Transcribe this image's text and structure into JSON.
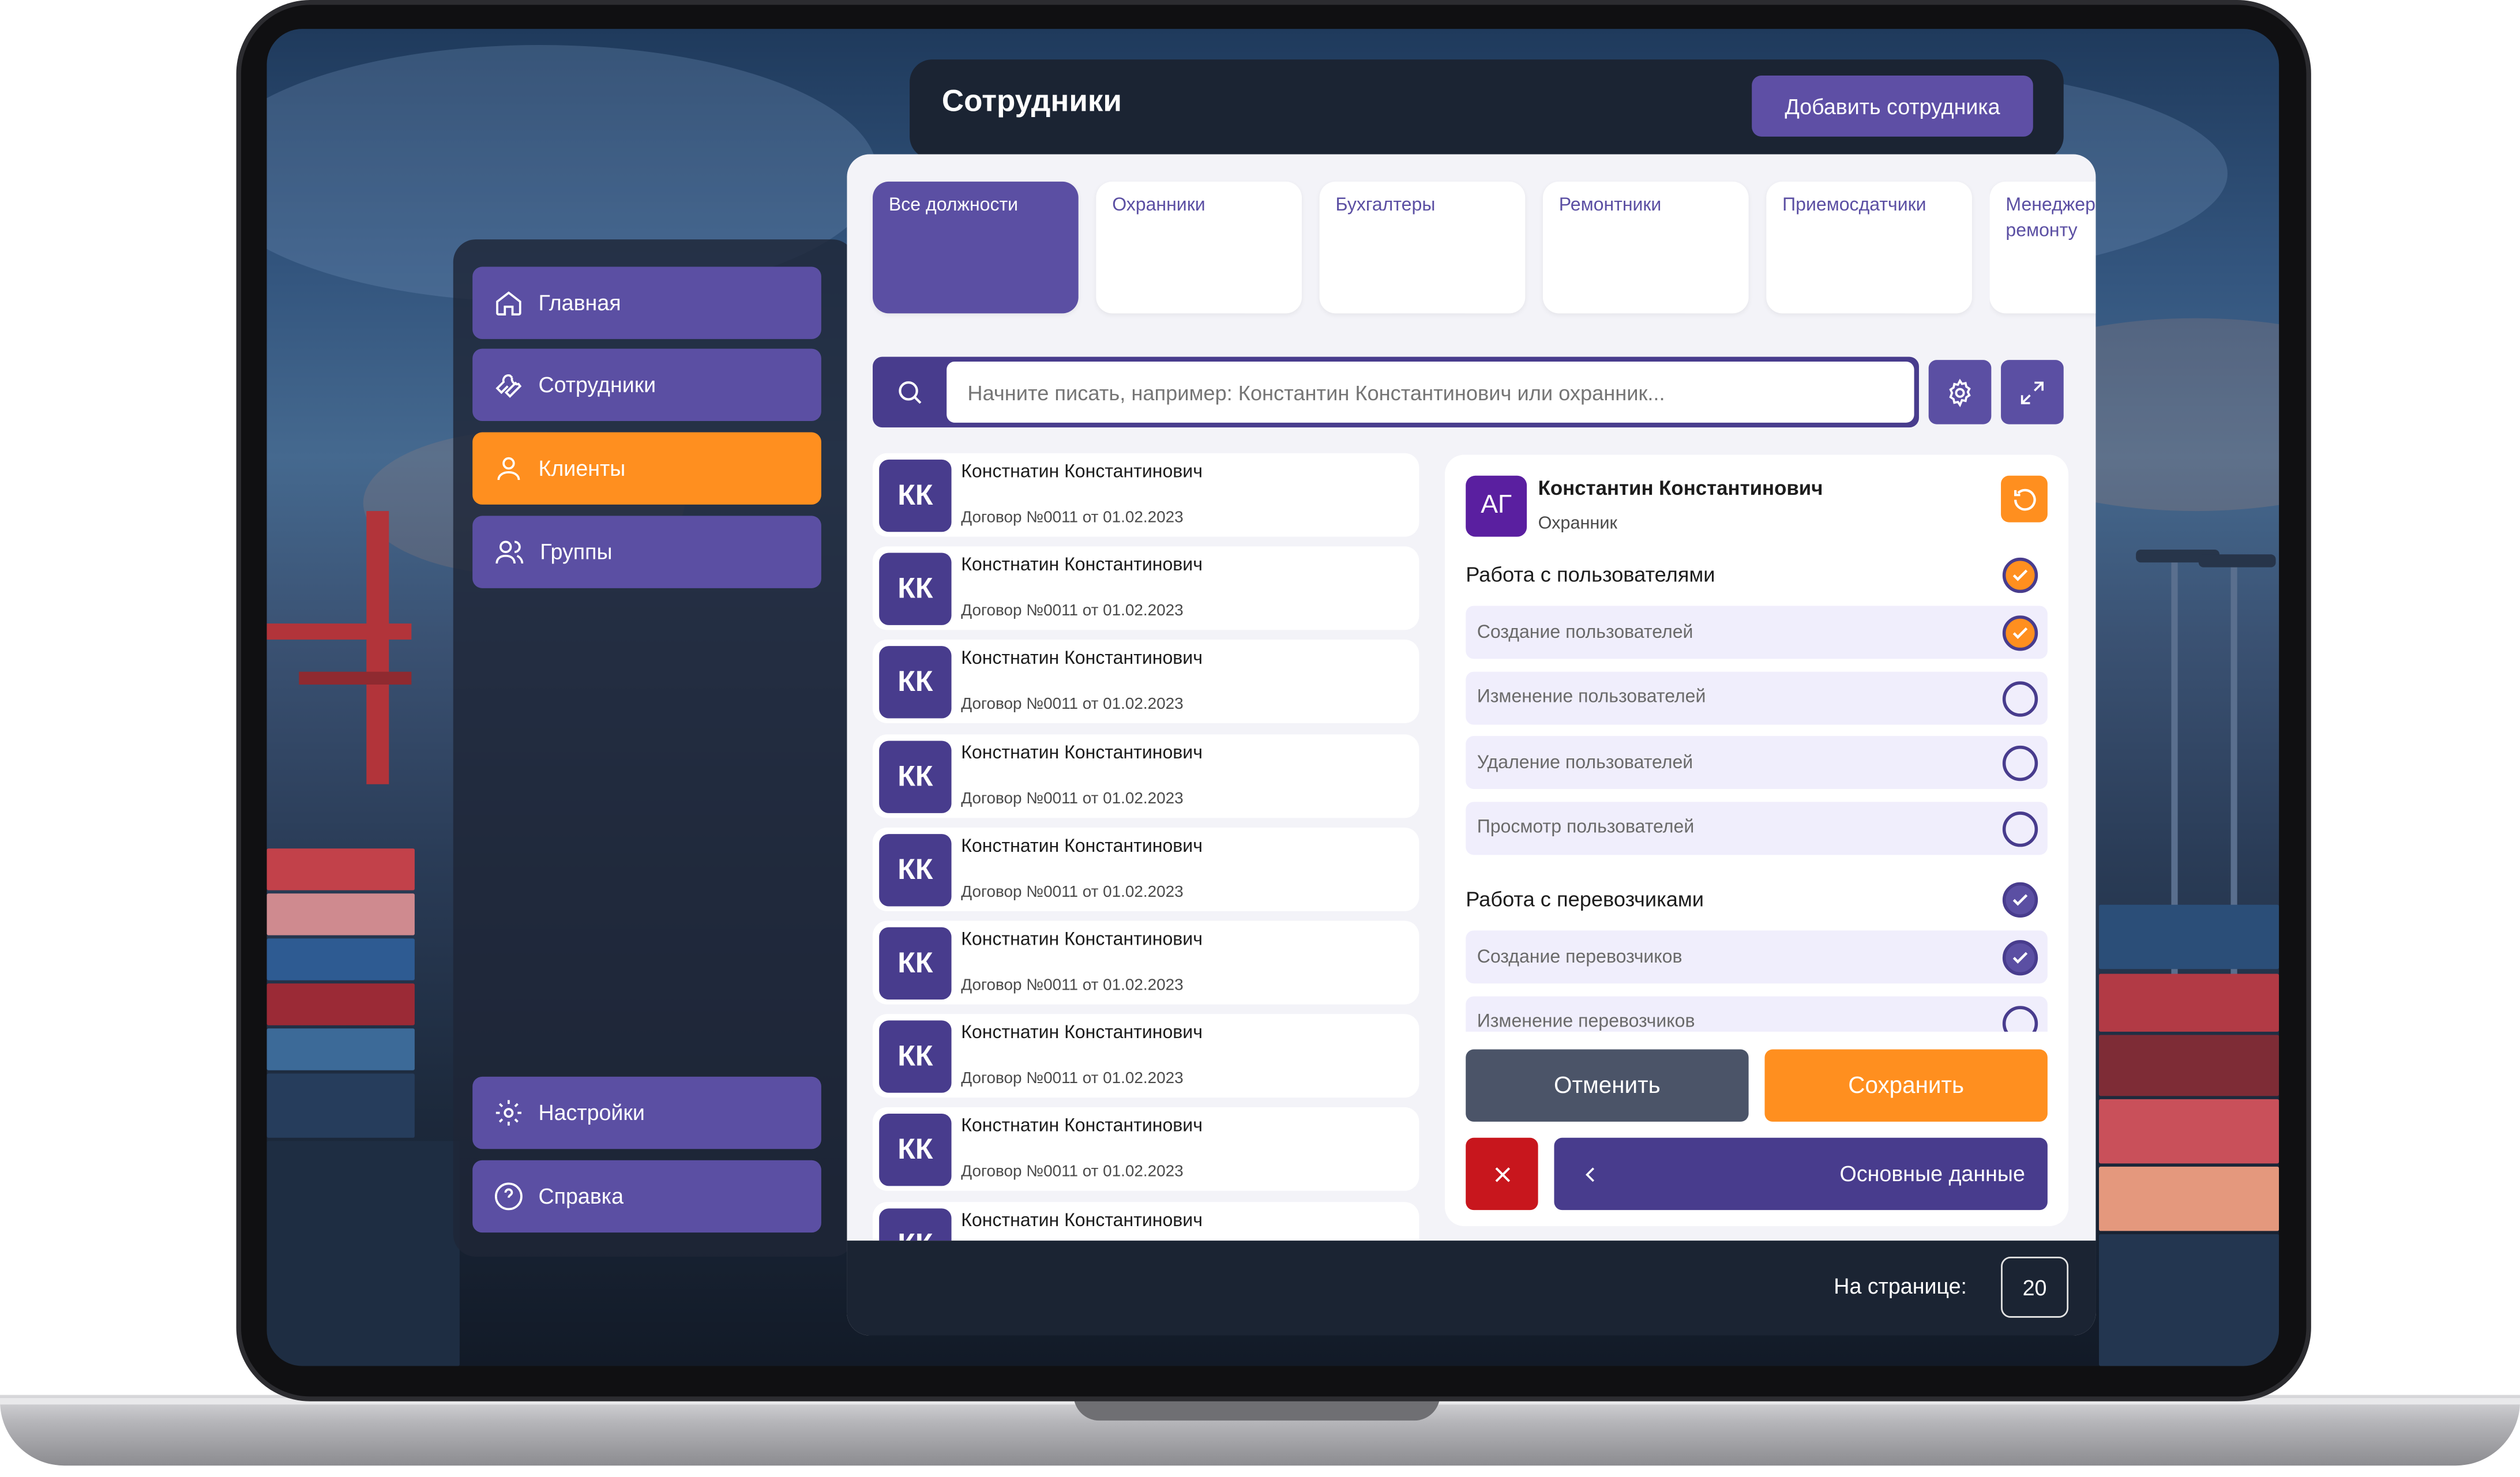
{
  "header": {
    "title": "Сотрудники",
    "add_button": "Добавить сотрудника"
  },
  "sidebar": {
    "items": [
      {
        "label": "Главная",
        "icon": "home-icon"
      },
      {
        "label": "Сотрудники",
        "icon": "wrench-icon"
      },
      {
        "label": "Клиенты",
        "icon": "user-icon",
        "active": true
      },
      {
        "label": "Группы",
        "icon": "users-icon"
      }
    ],
    "bottom": [
      {
        "label": "Настройки",
        "icon": "gear-icon"
      },
      {
        "label": "Справка",
        "icon": "help-icon"
      }
    ]
  },
  "tabs": [
    {
      "label": "Все должности",
      "active": true
    },
    {
      "label": "Охранники"
    },
    {
      "label": "Бухгалтеры"
    },
    {
      "label": "Ремонтники"
    },
    {
      "label": "Приемосдатчики"
    },
    {
      "label": "Менеджер по ремонту"
    }
  ],
  "search": {
    "placeholder": "Начните писать, например: Константин Константинович или охранник..."
  },
  "list": {
    "rows": [
      {
        "initials": "КК",
        "name": "Констнатин Константинович",
        "contract": "Договор №0011 от 01.02.2023"
      },
      {
        "initials": "КК",
        "name": "Констнатин Константинович",
        "contract": "Договор №0011 от 01.02.2023"
      },
      {
        "initials": "КК",
        "name": "Констнатин Константинович",
        "contract": "Договор №0011 от 01.02.2023"
      },
      {
        "initials": "КК",
        "name": "Констнатин Константинович",
        "contract": "Договор №0011 от 01.02.2023"
      },
      {
        "initials": "КК",
        "name": "Констнатин Константинович",
        "contract": "Договор №0011 от 01.02.2023"
      },
      {
        "initials": "КК",
        "name": "Констнатин Константинович",
        "contract": "Договор №0011 от 01.02.2023"
      },
      {
        "initials": "КК",
        "name": "Констнатин Константинович",
        "contract": "Договор №0011 от 01.02.2023"
      },
      {
        "initials": "КК",
        "name": "Констнатин Константинович",
        "contract": "Договор №0011 от 01.02.2023"
      },
      {
        "initials": "КК",
        "name": "Констнатин Константинович",
        "contract": ""
      }
    ]
  },
  "detail": {
    "initials": "АГ",
    "name": "Константин Константинович",
    "role": "Охранник",
    "sections": [
      {
        "title": "Работа с пользователями",
        "checked": true,
        "checked_color": "#ff8f1f",
        "items": [
          {
            "label": "Создание пользователей",
            "checked": true
          },
          {
            "label": "Изменение пользователей",
            "checked": false
          },
          {
            "label": "Удаление пользователей",
            "checked": false
          },
          {
            "label": "Просмотр пользователей",
            "checked": false
          }
        ]
      },
      {
        "title": "Работа с перевозчиками",
        "checked": true,
        "checked_color": "#5b4fa3",
        "items": [
          {
            "label": "Создание перевозчиков",
            "checked": true
          },
          {
            "label": "Изменение перевозчиков",
            "checked": false
          }
        ]
      }
    ],
    "cancel": "Отменить",
    "save": "Сохранить",
    "main_data": "Основные данные"
  },
  "footer": {
    "per_page_label": "На странице:",
    "per_page_value": "20"
  },
  "colors": {
    "accent": "#5b4fa3",
    "dark": "#483c8d",
    "orange": "#ff8f1f",
    "danger": "#c8161d",
    "panel": "#1b2433"
  }
}
